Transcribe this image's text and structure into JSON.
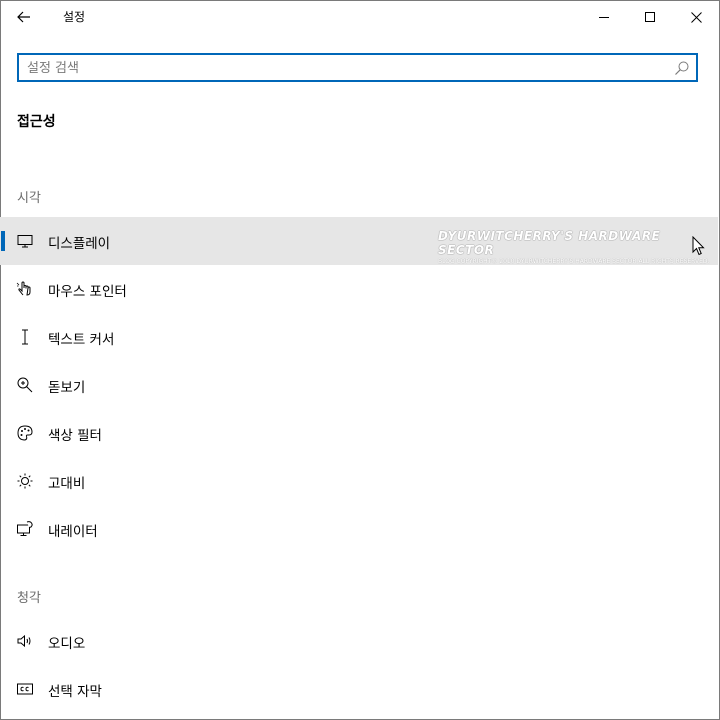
{
  "window": {
    "title": "설정",
    "back_icon": "arrow-left-icon",
    "minimize_icon": "minimize-icon",
    "maximize_icon": "maximize-icon",
    "close_icon": "close-icon"
  },
  "search": {
    "placeholder": "설정 검색",
    "value": "",
    "icon": "search-icon"
  },
  "page": {
    "title": "접근성"
  },
  "sections": {
    "vision": "시각",
    "hearing": "청각"
  },
  "nav_items": [
    {
      "label": "디스플레이",
      "icon": "monitor-icon",
      "selected": true
    },
    {
      "label": "마우스 포인터",
      "icon": "pointer-hand-icon",
      "selected": false
    },
    {
      "label": "텍스트 커서",
      "icon": "text-cursor-icon",
      "selected": false
    },
    {
      "label": "돋보기",
      "icon": "magnifier-icon",
      "selected": false
    },
    {
      "label": "색상 필터",
      "icon": "palette-icon",
      "selected": false
    },
    {
      "label": "고대비",
      "icon": "sun-icon",
      "selected": false
    },
    {
      "label": "내레이터",
      "icon": "narrator-icon",
      "selected": false
    },
    {
      "label": "오디오",
      "icon": "speaker-icon",
      "selected": false
    },
    {
      "label": "선택 자막",
      "icon": "closed-caption-icon",
      "selected": false
    }
  ],
  "watermark": {
    "main": "DYURWITCHERRY'S HARDWARE SECTOR",
    "sub": "BLOG COPYRIGHT© 2010 DYURWITCHERRY'S HARDWARE SECTOR ALL RIGHTS RESERVED."
  },
  "colors": {
    "accent": "#0067b8",
    "selected_bg": "#e6e6e6",
    "section_text": "#6b6b6b"
  }
}
